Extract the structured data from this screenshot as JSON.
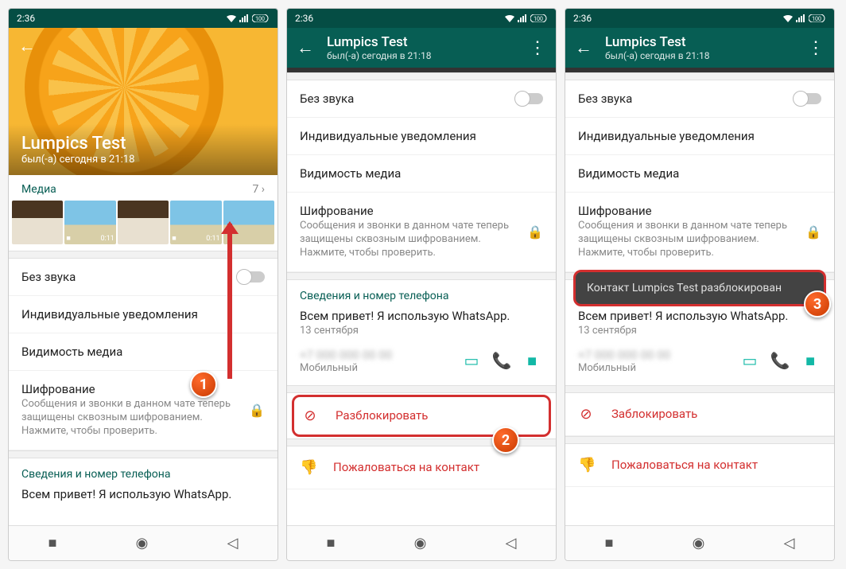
{
  "statusbar": {
    "time": "2:36"
  },
  "contact": {
    "name": "Lumpics Test",
    "last_seen": "был(-а) сегодня в 21:18"
  },
  "media": {
    "header": "Медиа",
    "count": "7 ›",
    "durations": [
      "",
      "0:11",
      "",
      "0:11",
      ""
    ]
  },
  "settings": {
    "mute": "Без звука",
    "notifications": "Индивидуальные уведомления",
    "media_visibility": "Видимость медиа",
    "encryption": "Шифрование",
    "encryption_sub": "Сообщения и звонки в данном чате теперь защищены сквозным шифрованием. Нажмите, чтобы проверить."
  },
  "info": {
    "header": "Сведения и номер телефона",
    "status": "Всем привет! Я использую WhatsApp.",
    "date": "13 сентября",
    "phone_type": "Мобильный"
  },
  "actions": {
    "unblock": "Разблокировать",
    "block": "Заблокировать",
    "report": "Пожаловаться на контакт"
  },
  "toast": "Контакт Lumpics Test разблокирован",
  "callouts": {
    "c1": "1",
    "c2": "2",
    "c3": "3"
  }
}
